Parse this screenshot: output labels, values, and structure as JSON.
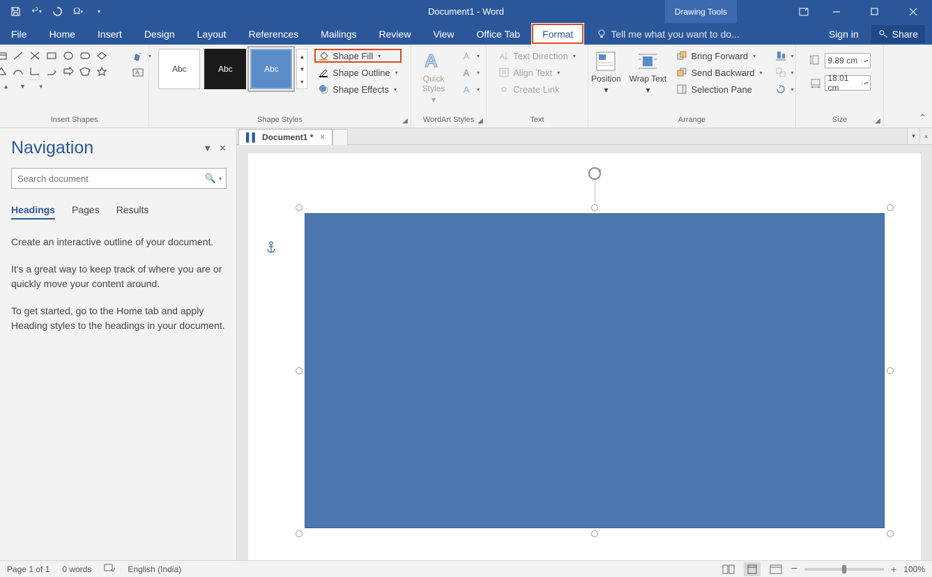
{
  "title": "Document1 - Word",
  "context_tab": "Drawing Tools",
  "tabs": [
    "File",
    "Home",
    "Insert",
    "Design",
    "Layout",
    "References",
    "Mailings",
    "Review",
    "View",
    "Office Tab",
    "Format"
  ],
  "active_tab": "Format",
  "tellme": "Tell me what you want to do...",
  "signin": "Sign in",
  "share": "Share",
  "groups": {
    "insert_shapes": "Insert Shapes",
    "shape_styles": "Shape Styles",
    "wordart_styles": "WordArt Styles",
    "text": "Text",
    "arrange": "Arrange",
    "size": "Size"
  },
  "style_abc": "Abc",
  "shape_fill": "Shape Fill",
  "shape_outline": "Shape Outline",
  "shape_effects": "Shape Effects",
  "quick_styles": "Quick Styles",
  "text_direction": "Text Direction",
  "align_text": "Align Text",
  "create_link": "Create Link",
  "position": "Position",
  "wrap_text": "Wrap Text",
  "bring_forward": "Bring Forward",
  "send_backward": "Send Backward",
  "selection_pane": "Selection Pane",
  "size_h": "9.89 cm",
  "size_w": "18.01 cm",
  "nav": {
    "title": "Navigation",
    "search_ph": "Search document",
    "tabs": [
      "Headings",
      "Pages",
      "Results"
    ],
    "p1": "Create an interactive outline of your document.",
    "p2": "It's a great way to keep track of where you are or quickly move your content around.",
    "p3": "To get started, go to the Home tab and apply Heading styles to the headings in your document."
  },
  "doc_tab": "Document1 *",
  "status": {
    "page": "Page 1 of 1",
    "words": "0 words",
    "lang": "English (India)",
    "zoom": "100%"
  }
}
